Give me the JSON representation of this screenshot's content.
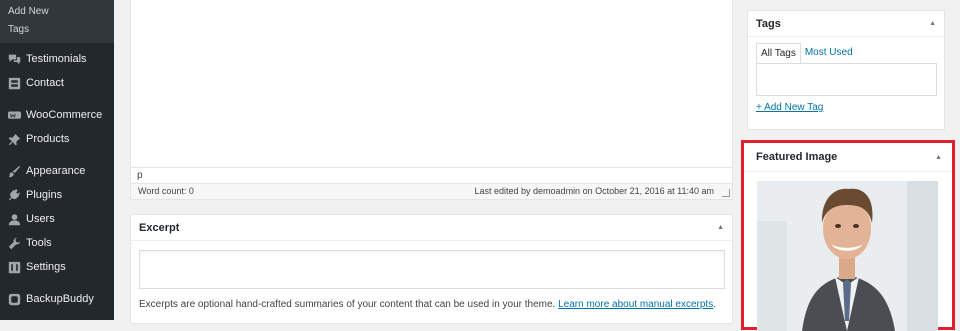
{
  "sidebar": {
    "submenu": [
      {
        "label": "Add New"
      },
      {
        "label": "Tags"
      }
    ],
    "items": [
      {
        "label": "Testimonials",
        "icon": "testimonials-icon"
      },
      {
        "label": "Contact",
        "icon": "contact-icon"
      },
      {
        "label": "WooCommerce",
        "icon": "woocommerce-icon"
      },
      {
        "label": "Products",
        "icon": "pin-icon"
      },
      {
        "label": "Appearance",
        "icon": "brush-icon"
      },
      {
        "label": "Plugins",
        "icon": "plug-icon"
      },
      {
        "label": "Users",
        "icon": "user-icon"
      },
      {
        "label": "Tools",
        "icon": "wrench-icon"
      },
      {
        "label": "Settings",
        "icon": "settings-icon"
      },
      {
        "label": "BackupBuddy",
        "icon": "backup-icon"
      }
    ]
  },
  "editor": {
    "path": "p",
    "word_count": "Word count: 0",
    "last_edited": "Last edited by demoadmin on October 21, 2016 at 11:40 am"
  },
  "excerpt": {
    "title": "Excerpt",
    "help_text": "Excerpts are optional hand-crafted summaries of your content that can be used in your theme.",
    "help_link": "Learn more about manual excerpts",
    "help_end": "."
  },
  "tags": {
    "title": "Tags",
    "tab_all": "All Tags",
    "tab_used": "Most Used",
    "add_new": "+ Add New Tag"
  },
  "featured_image": {
    "title": "Featured Image"
  },
  "colors": {
    "sidebar_bg": "#23282d",
    "link": "#0073aa",
    "highlight_border": "#e2202d"
  }
}
